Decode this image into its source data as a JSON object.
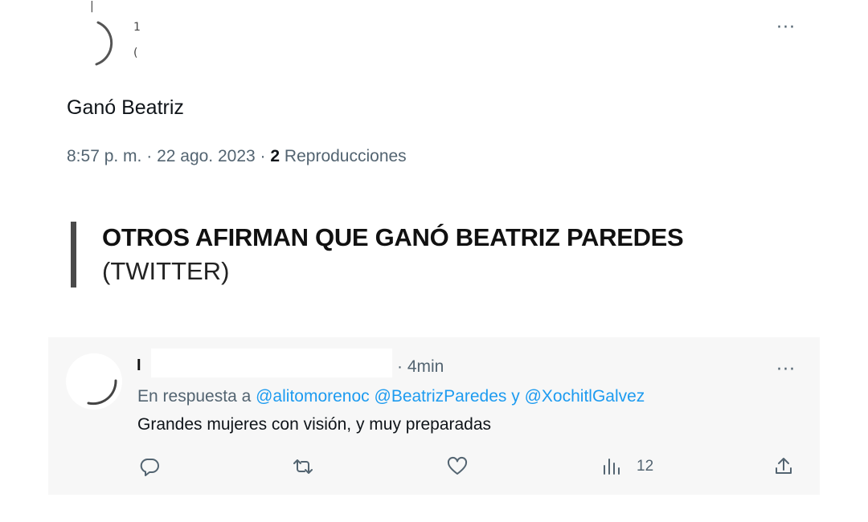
{
  "tweet": {
    "text": "Ganó Beatriz",
    "time": "8:57 p. m.",
    "date": "22 ago. 2023",
    "views_count": "2",
    "views_label": "Reproducciones",
    "separator": "·",
    "more": "···",
    "name_fragment": "1",
    "handle_fragment": "("
  },
  "caption": {
    "title": "OTROS AFIRMAN QUE GANÓ BEATRIZ PAREDES",
    "source": "(TWITTER)"
  },
  "reply": {
    "name_initial": "I",
    "time": "· 4min",
    "more": "···",
    "replying_to_prefix": "En respuesta a",
    "mentions": [
      "@alitomorenoc",
      "@BeatrizParedes",
      "@XochitlGalvez"
    ],
    "conjunction": "y",
    "text": "Grandes mujeres con visión, y muy preparadas",
    "actions": {
      "reply_icon": "comment-icon",
      "retweet_icon": "retweet-icon",
      "like_icon": "heart-icon",
      "views_icon": "analytics-icon",
      "views_count": "12",
      "share_icon": "share-icon"
    }
  },
  "colors": {
    "text": "#0f1419",
    "secondary": "#536471",
    "link": "#1d9bf0",
    "card_bg": "#f7f7f7",
    "caption_bar": "#4a4a4a"
  }
}
